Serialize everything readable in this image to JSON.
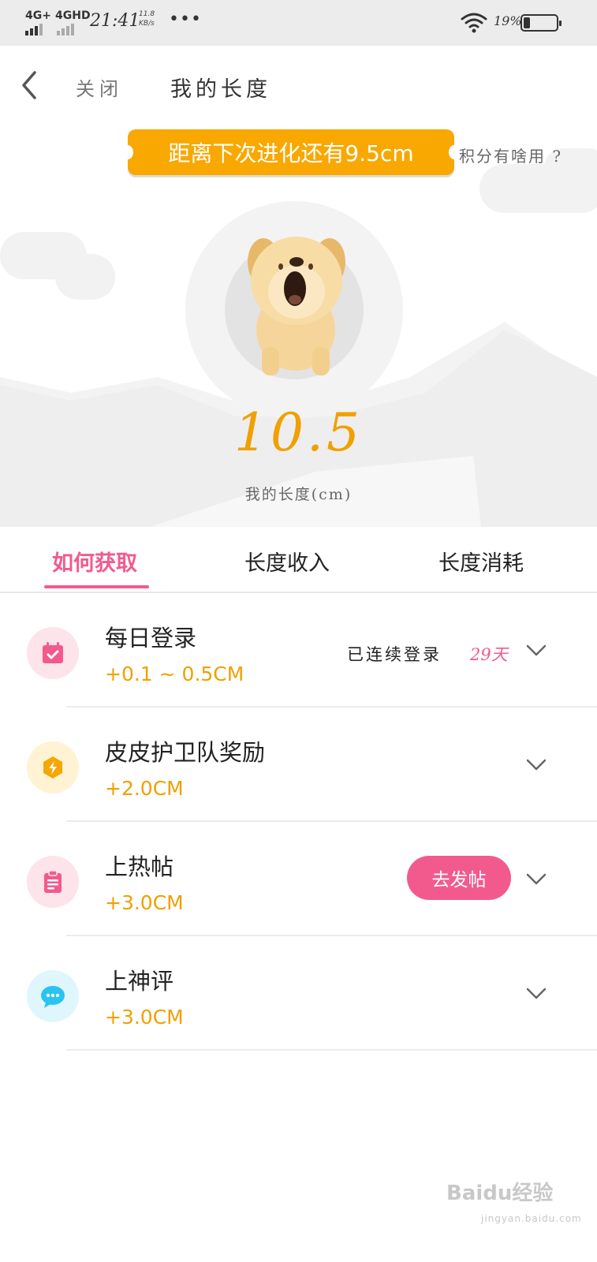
{
  "status_bar": {
    "network1": "4G+",
    "network2": "4GHD",
    "time": "21:41",
    "speed_value": "11.8",
    "speed_unit": "KB/s",
    "more": "•••",
    "battery_percent": "19%",
    "battery_level": 0.19
  },
  "nav": {
    "close_label": "关闭",
    "title": "我的长度"
  },
  "hero": {
    "banner_text": "距离下次进化还有9.5cm",
    "help_text": "积分有啥用 ?",
    "length_value": "10.5",
    "length_label": "我的长度(cm)"
  },
  "tabs": [
    {
      "label": "如何获取",
      "active": true
    },
    {
      "label": "长度收入",
      "active": false
    },
    {
      "label": "长度消耗",
      "active": false
    }
  ],
  "items": [
    {
      "title": "每日登录",
      "reward": "+0.1 ~ 0.5CM",
      "icon": "calendar-icon",
      "icon_color": "#f25a8e",
      "bg_color": "#fde3ea",
      "streak_label": "已连续登录",
      "streak_days": "29天"
    },
    {
      "title": "皮皮护卫队奖励",
      "reward": "+2.0CM",
      "icon": "lightning-hexagon-icon",
      "icon_color": "#f5a700",
      "bg_color": "#fff3d4"
    },
    {
      "title": "上热帖",
      "reward": "+3.0CM",
      "icon": "clipboard-icon",
      "icon_color": "#f25a8e",
      "bg_color": "#fde3ea",
      "action_label": "去发帖"
    },
    {
      "title": "上神评",
      "reward": "+3.0CM",
      "icon": "chat-bubble-icon",
      "icon_color": "#29c3f0",
      "bg_color": "#dff6fd"
    }
  ],
  "colors": {
    "accent_pink": "#f25a8e",
    "accent_orange": "#f0a000",
    "banner_orange": "#f8a800"
  },
  "watermark": {
    "main": "Baidu经验",
    "sub": "jingyan.baidu.com"
  }
}
